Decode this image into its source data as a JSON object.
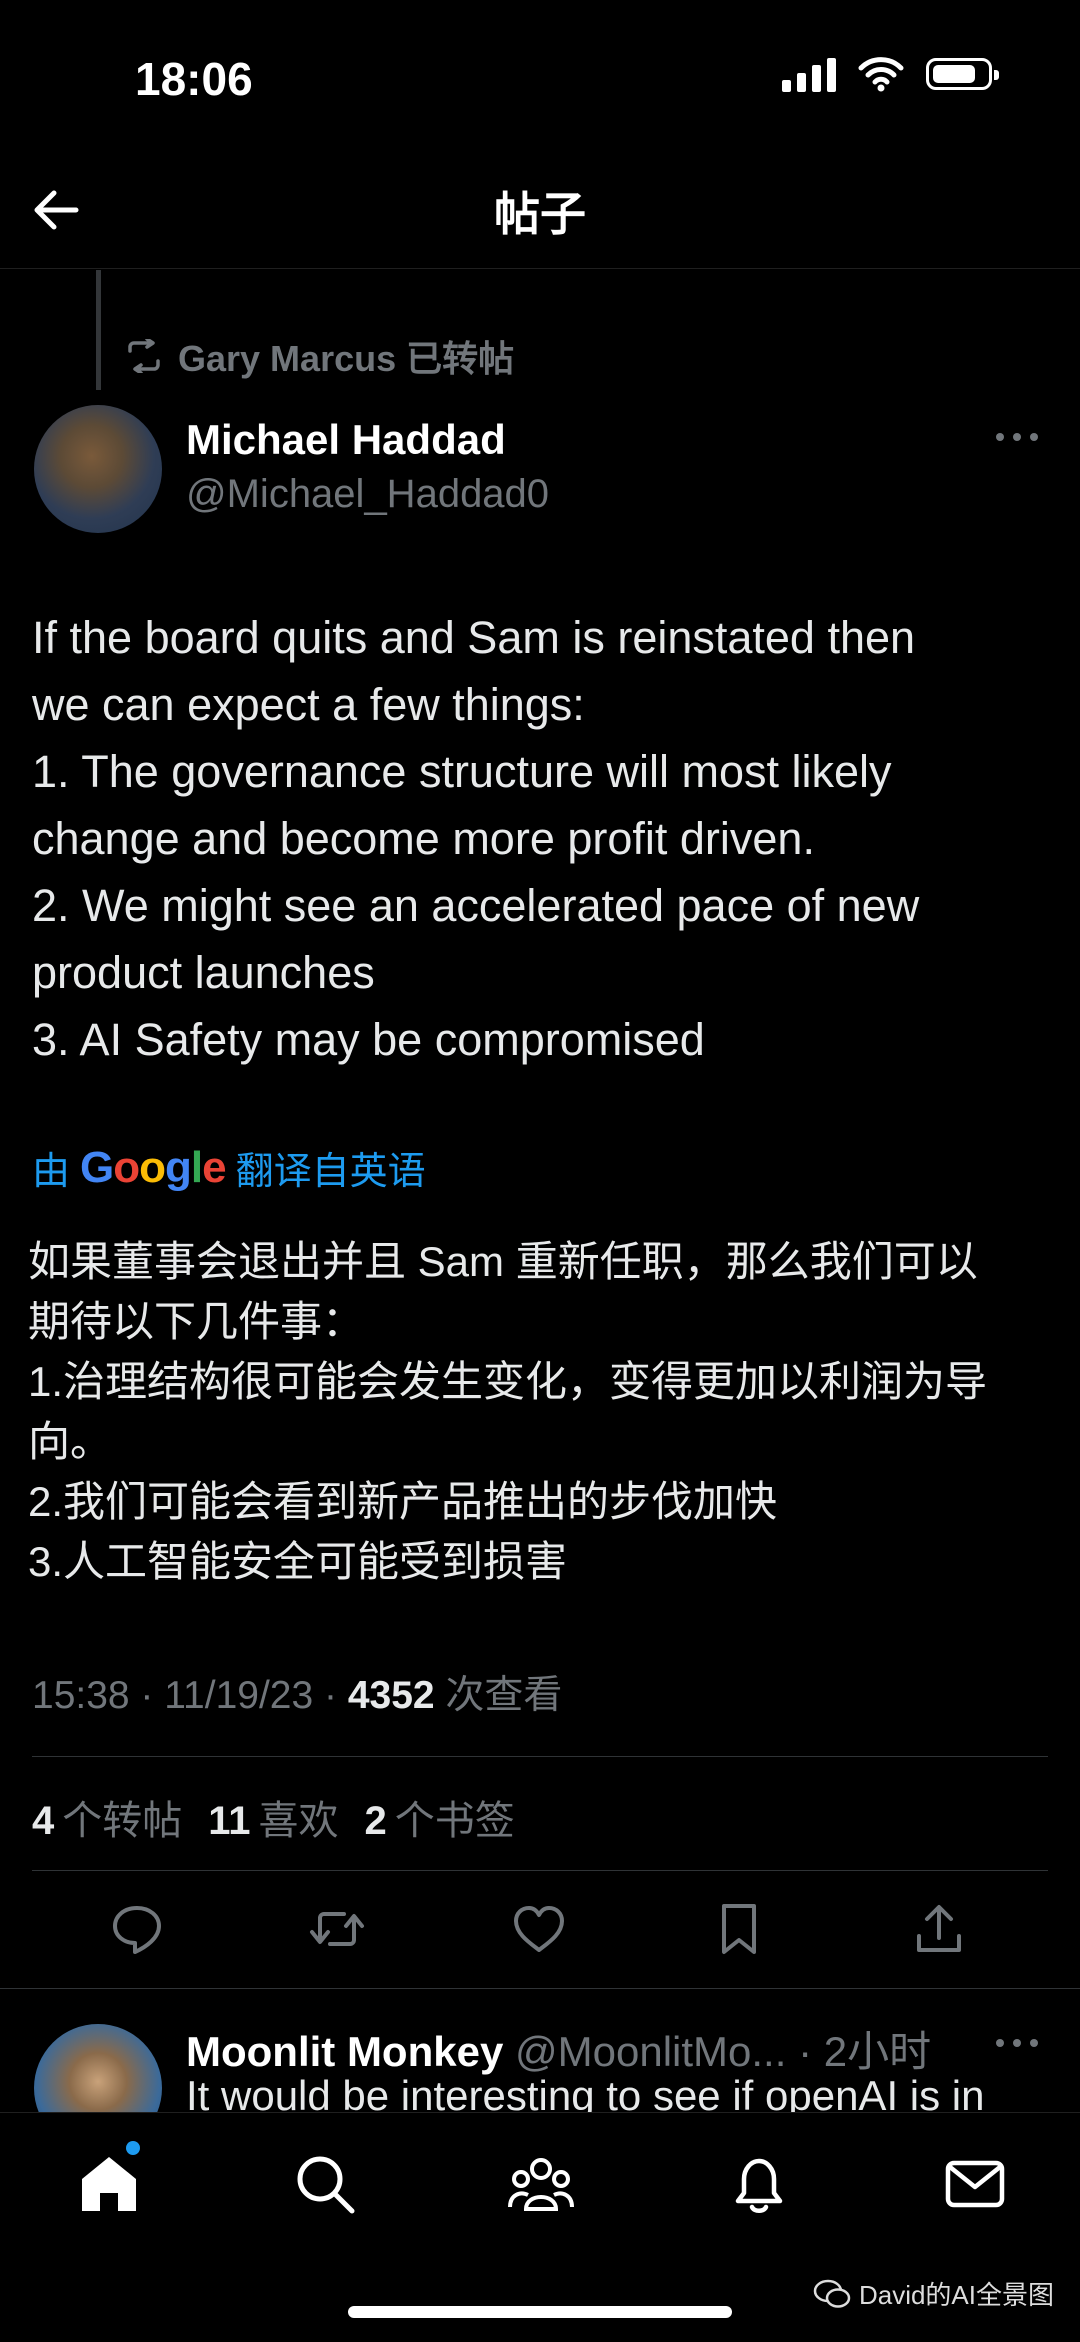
{
  "status_bar": {
    "time": "18:06"
  },
  "nav": {
    "title": "帖子"
  },
  "repost": {
    "text": "Gary Marcus 已转帖"
  },
  "author": {
    "name": "Michael Haddad",
    "handle": "@Michael_Haddad0"
  },
  "tweet": {
    "lines": [
      "If the board quits and Sam is reinstated then",
      "we can expect a few things:",
      "1. The governance structure will most likely",
      "change and become more profit driven.",
      "2. We might see an accelerated pace of new",
      "product launches",
      "3. AI Safety may be compromised"
    ]
  },
  "translation": {
    "prefix": "由",
    "brand": "Google",
    "suffix": "翻译自英语",
    "lines": [
      "如果董事会退出并且 Sam 重新任职，那么我们可以",
      "期待以下几件事：",
      "1.治理结构很可能会发生变化，变得更加以利润为导",
      "向。",
      "2.我们可能会看到新产品推出的步伐加快",
      "3.人工智能安全可能受到损害"
    ]
  },
  "meta": {
    "time": "15:38 · 11/19/23 · ",
    "views": "4352",
    "views_label": " 次查看"
  },
  "stats": {
    "reposts": "4",
    "reposts_label": "个转帖",
    "likes": "11",
    "likes_label": "喜欢",
    "bookmarks": "2",
    "bookmarks_label": "个书签"
  },
  "reply": {
    "name": "Moonlit Monkey",
    "handle": " @MoonlitMo...",
    "time": "· 2小时",
    "text": "It would be interesting to see if openAI is in"
  },
  "watermark": "David的AI全景图",
  "colors": {
    "background": "#000000",
    "accent": "#1d9bf0",
    "muted": "#71767b",
    "text": "#e7e9ea"
  }
}
